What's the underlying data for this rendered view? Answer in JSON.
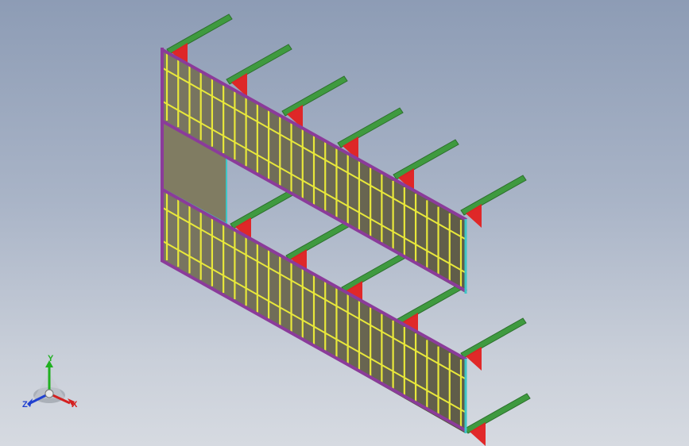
{
  "viewport": {
    "background_top": "#8d9cb5",
    "background_bottom": "#d6dae1"
  },
  "model": {
    "colors": {
      "panel": "#6f6c57",
      "panel_dark": "#55533f",
      "stud": "#e8e83a",
      "top_beam": "#8b3b9a",
      "arm": "#3f9a3f",
      "arm_dark": "#2c6f2c",
      "brace": "#e22020",
      "frame": "#3ec6c6"
    }
  },
  "triad": {
    "x_label": "X",
    "y_label": "Y",
    "z_label": "Z",
    "x_color": "#d42020",
    "y_color": "#20b020",
    "z_color": "#2040d0"
  }
}
